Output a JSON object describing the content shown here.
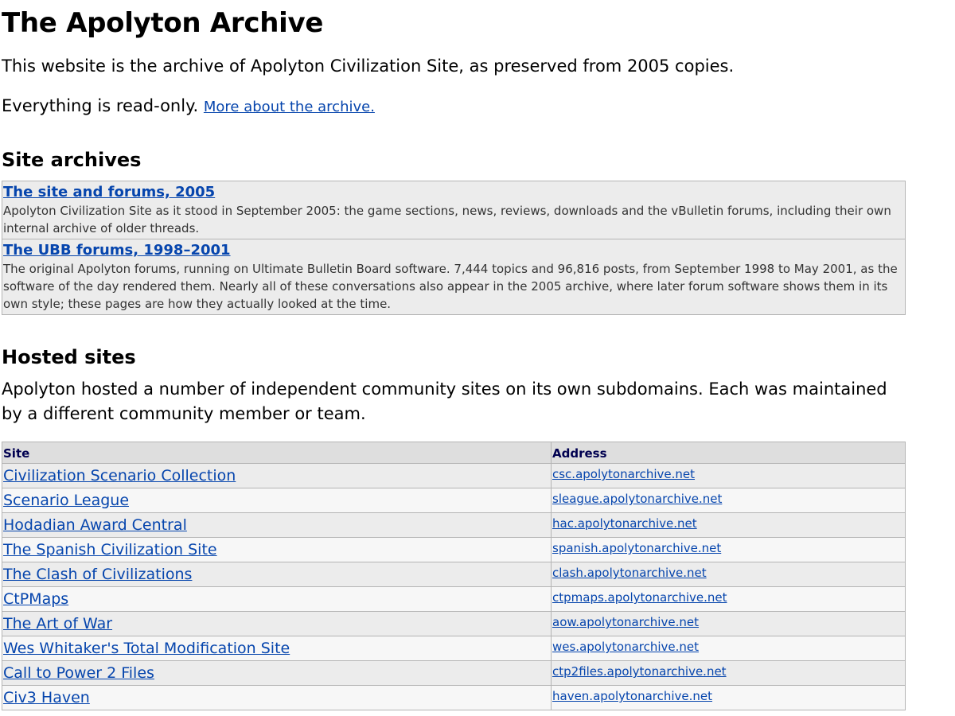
{
  "header": {
    "title": "The Apolyton Archive",
    "intro1": "This website is the archive of Apolyton Civilization Site, as preserved from 2005 copies.",
    "intro2_text": "Everything is read-only.",
    "intro2_link": "More about the archive."
  },
  "site_archives": {
    "heading": "Site archives",
    "items": [
      {
        "title": "The site and forums, 2005",
        "description": "Apolyton Civilization Site as it stood in September 2005: the game sections, news, reviews, downloads and the vBulletin forums, including their own internal archive of older threads."
      },
      {
        "title": "The UBB forums, 1998–2001",
        "description": "The original Apolyton forums, running on Ultimate Bulletin Board software. 7,444 topics and 96,816 posts, from September 1998 to May 2001, as the software of the day rendered them. Nearly all of these conversations also appear in the 2005 archive, where later forum software shows them in its own style; these pages are how they actually looked at the time."
      }
    ]
  },
  "hosted_sites": {
    "heading": "Hosted sites",
    "intro": "Apolyton hosted a number of independent community sites on its own subdomains. Each was maintained by a different community member or team.",
    "columns": [
      "Site",
      "Address"
    ],
    "rows": [
      {
        "site": "Civilization Scenario Collection",
        "address": "csc.apolytonarchive.net"
      },
      {
        "site": "Scenario League",
        "address": "sleague.apolytonarchive.net"
      },
      {
        "site": "Hodadian Award Central",
        "address": "hac.apolytonarchive.net"
      },
      {
        "site": "The Spanish Civilization Site",
        "address": "spanish.apolytonarchive.net"
      },
      {
        "site": "The Clash of Civilizations",
        "address": "clash.apolytonarchive.net"
      },
      {
        "site": "CtPMaps",
        "address": "ctpmaps.apolytonarchive.net"
      },
      {
        "site": "The Art of War",
        "address": "aow.apolytonarchive.net"
      },
      {
        "site": "Wes Whitaker's Total Modification Site",
        "address": "wes.apolytonarchive.net"
      },
      {
        "site": "Call to Power 2 Files",
        "address": "ctp2files.apolytonarchive.net"
      },
      {
        "site": "Civ3 Haven",
        "address": "haven.apolytonarchive.net"
      }
    ]
  },
  "colors": {
    "link": "#0645ad",
    "table_row_odd": "#ececec",
    "table_row_even": "#f7f7f7",
    "table_header_bg": "#dedede",
    "table_border": "#b4b4b4"
  }
}
